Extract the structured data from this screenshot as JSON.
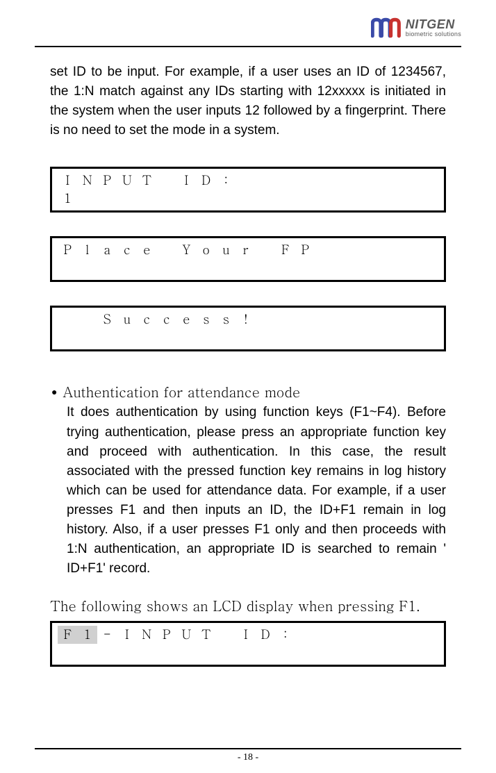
{
  "brand": {
    "name": "NITGEN",
    "sub": "biometric solutions"
  },
  "intro_paragraph": "set ID to be input. For example, if a user uses an ID of 1234567, the 1:N match against any IDs starting with 12xxxxx is initiated in the system when the user inputs 12 followed by a fingerprint. There is no need to set the mode in a system.",
  "lcd1": {
    "row1": [
      "I",
      "N",
      "P",
      "U",
      "T",
      "",
      "I",
      "D",
      ":",
      "",
      "",
      "",
      "",
      "",
      "",
      "",
      ""
    ],
    "row2": [
      "1",
      "",
      "",
      "",
      "",
      "",
      "",
      "",
      "",
      "",
      "",
      "",
      "",
      "",
      "",
      "",
      ""
    ]
  },
  "lcd2": {
    "row1": [
      "P",
      "l",
      "a",
      "c",
      "e",
      "",
      "Y",
      "o",
      "u",
      "r",
      "",
      "F",
      "P",
      "",
      "",
      "",
      ""
    ],
    "row2": [
      "",
      "",
      "",
      "",
      "",
      "",
      "",
      "",
      "",
      "",
      "",
      "",
      "",
      "",
      "",
      "",
      ""
    ]
  },
  "lcd3": {
    "row1": [
      "",
      "",
      "S",
      "u",
      "c",
      "c",
      "e",
      "s",
      "s",
      "!",
      "",
      "",
      "",
      "",
      "",
      "",
      ""
    ],
    "row2": [
      "",
      "",
      "",
      "",
      "",
      "",
      "",
      "",
      "",
      "",
      "",
      "",
      "",
      "",
      "",
      "",
      ""
    ]
  },
  "bullet": {
    "title": "Authentication for attendance mode",
    "body": "It does authentication by using function keys (F1~F4). Before trying authentication, please press an appropriate function key and proceed with authentication. In this case, the result associated with the pressed function key remains in log history which can be used for attendance data. For example, if a user presses F1 and then inputs an ID, the ID+F1 remain in log history. Also, if a user presses F1 only and then proceeds with 1:N authentication, an appropriate ID is searched to remain ' ID+F1'  record."
  },
  "mid_text": "The following shows an LCD display when pressing F1.",
  "lcd4": {
    "row1": [
      "F",
      "1",
      "-",
      "I",
      "N",
      "P",
      "U",
      "T",
      "",
      "I",
      "D",
      ":",
      "",
      "",
      "",
      "",
      ""
    ],
    "shaded1": [
      true,
      true,
      false,
      false,
      false,
      false,
      false,
      false,
      false,
      false,
      false,
      false,
      false,
      false,
      false,
      false,
      false
    ],
    "row2": [
      "",
      "",
      "",
      "",
      "",
      "",
      "",
      "",
      "",
      "",
      "",
      "",
      "",
      "",
      "",
      "",
      ""
    ]
  },
  "page_number": "- 18 -"
}
